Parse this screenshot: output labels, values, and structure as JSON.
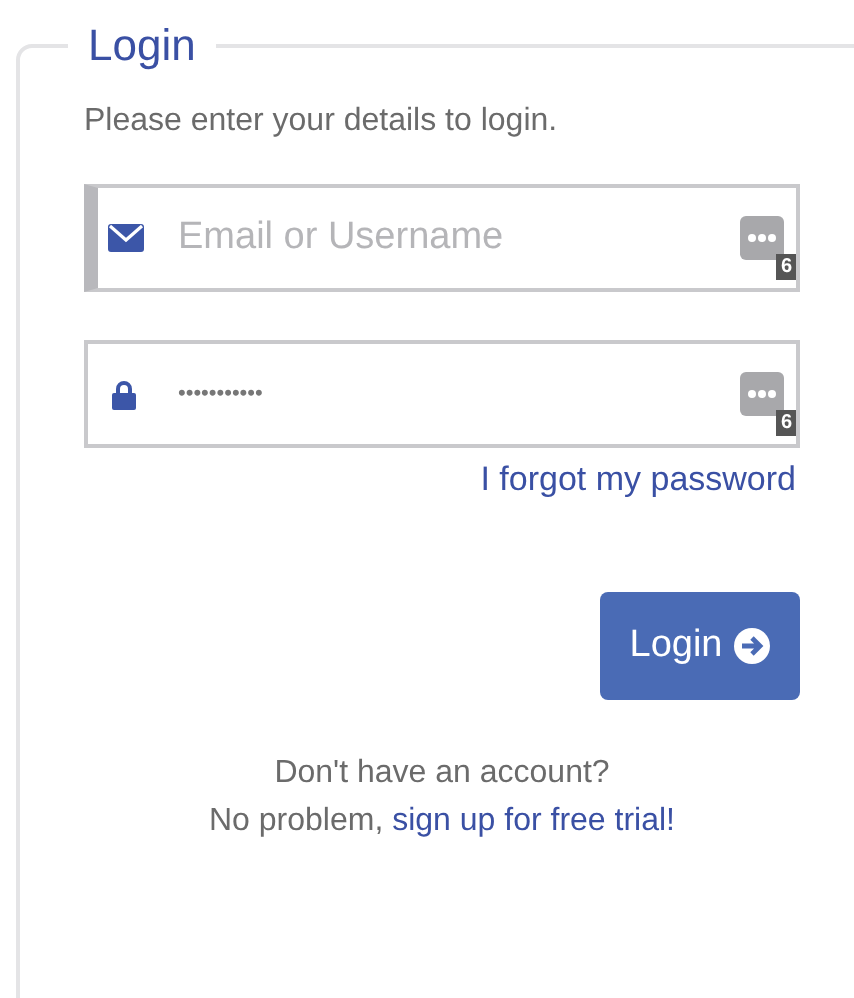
{
  "form": {
    "legend": "Login",
    "instructions": "Please enter your details to login.",
    "fields": [
      {
        "kind": "email",
        "placeholder": "Email or Username",
        "focused": true,
        "manager_badge": "6"
      },
      {
        "kind": "password",
        "value": "•••••••••••",
        "focused": false,
        "manager_badge": "6"
      }
    ],
    "forgot_link": "I forgot my password",
    "submit": "Login",
    "signup_question": "Don't have an account?",
    "signup_prefix": "No problem, ",
    "signup_link": "sign up for free trial!"
  }
}
